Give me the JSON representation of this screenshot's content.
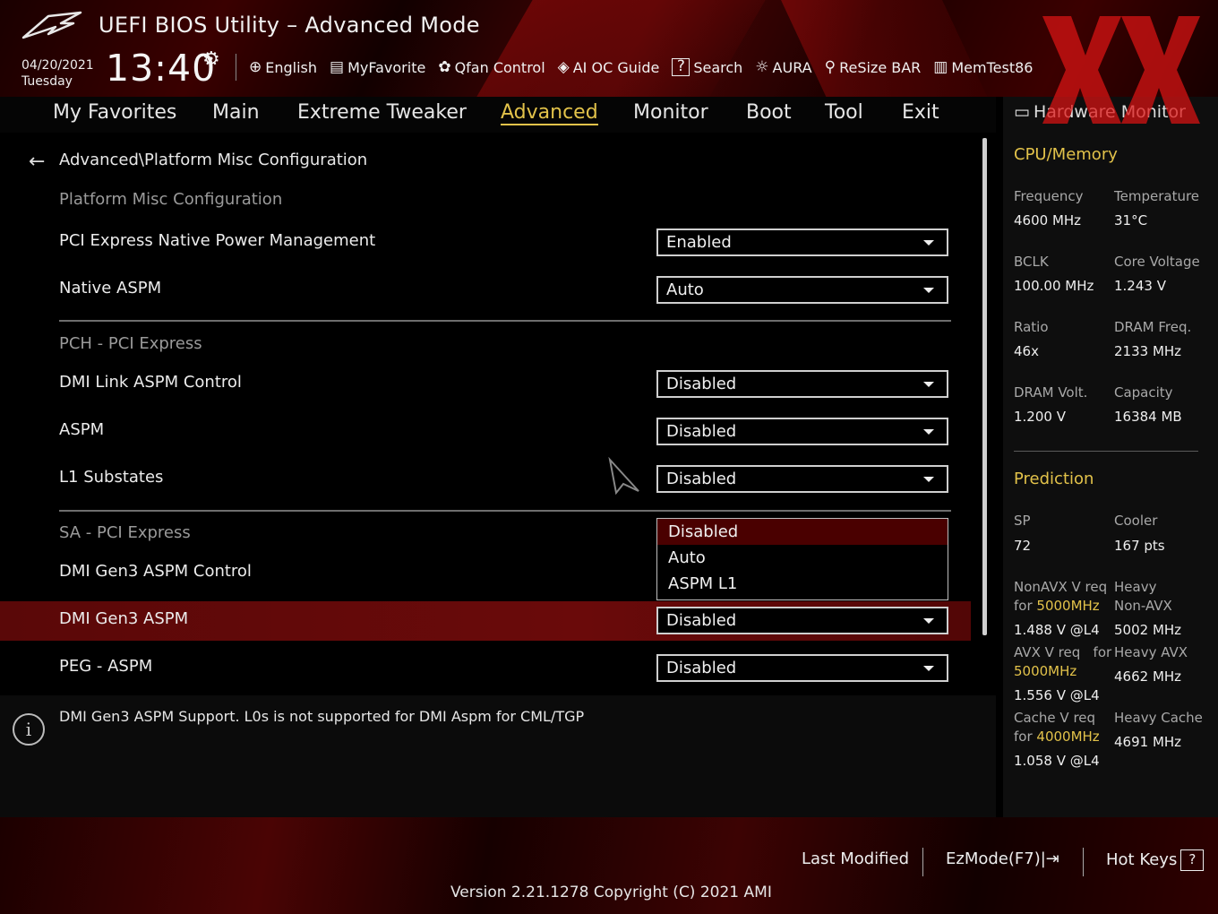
{
  "header": {
    "title": "UEFI BIOS Utility – Advanced Mode",
    "date": "04/20/2021",
    "day": "Tuesday",
    "time": "13:40",
    "toolbar": [
      {
        "label": "English",
        "icon": "globe-icon"
      },
      {
        "label": "MyFavorite",
        "icon": "favorite-icon"
      },
      {
        "label": "Qfan Control",
        "icon": "fan-icon"
      },
      {
        "label": "AI OC Guide",
        "icon": "ai-oc-icon"
      },
      {
        "label": "Search",
        "icon": "search-help-icon"
      },
      {
        "label": "AURA",
        "icon": "aura-icon"
      },
      {
        "label": "ReSize BAR",
        "icon": "resize-bar-icon"
      },
      {
        "label": "MemTest86",
        "icon": "memtest-icon"
      }
    ]
  },
  "nav": {
    "tabs": [
      "My Favorites",
      "Main",
      "Extreme Tweaker",
      "Advanced",
      "Monitor",
      "Boot",
      "Tool",
      "Exit"
    ],
    "active": "Advanced"
  },
  "main": {
    "breadcrumb": "Advanced\\Platform Misc Configuration",
    "sections": {
      "platform": "Platform Misc Configuration",
      "pch": "PCH - PCI Express",
      "sa": "SA - PCI Express"
    },
    "settings": [
      {
        "label": "PCI Express Native Power Management",
        "value": "Enabled"
      },
      {
        "label": "Native ASPM",
        "value": "Auto"
      },
      {
        "label": "DMI Link ASPM Control",
        "value": "Disabled"
      },
      {
        "label": "ASPM",
        "value": "Disabled"
      },
      {
        "label": "L1 Substates",
        "value": "Disabled"
      },
      {
        "label": "DMI Gen3 ASPM Control",
        "value": ""
      },
      {
        "label": "DMI Gen3 ASPM",
        "value": "Disabled"
      },
      {
        "label": "PEG - ASPM",
        "value": "Disabled"
      }
    ],
    "dropdown_options": [
      "Disabled",
      "Auto",
      "ASPM L1"
    ]
  },
  "help": {
    "text": "DMI Gen3 ASPM Support.  L0s is not supported for DMI Aspm for CML/TGP"
  },
  "hw": {
    "title": "Hardware Monitor",
    "cpu_section": "CPU/Memory",
    "cpu": [
      {
        "label": "Frequency",
        "value": "4600 MHz"
      },
      {
        "label": "Temperature",
        "value": "31°C"
      },
      {
        "label": "BCLK",
        "value": "100.00 MHz"
      },
      {
        "label": "Core Voltage",
        "value": "1.243 V"
      },
      {
        "label": "Ratio",
        "value": "46x"
      },
      {
        "label": "DRAM Freq.",
        "value": "2133 MHz"
      },
      {
        "label": "DRAM Volt.",
        "value": "1.200 V"
      },
      {
        "label": "Capacity",
        "value": "16384 MB"
      }
    ],
    "pred_section": "Prediction",
    "sp_label": "SP",
    "sp_value": "72",
    "cooler_label": "Cooler",
    "cooler_value": "167 pts",
    "nonavx_req": "NonAVX V req",
    "for": "for",
    "nonavx_freq": "5000MHz",
    "nonavx_v": "1.488 V @L4",
    "heavy": "Heavy",
    "non_avx": "Non-AVX",
    "heavy_nonavx_v": "5002 MHz",
    "avx_req": "AVX V req",
    "avx_for": "for",
    "avx_freq": "5000MHz",
    "avx_v": "1.556 V @L4",
    "heavy_avx": "Heavy AVX",
    "heavy_avx_v": "4662 MHz",
    "cache_req": "Cache V req",
    "cache_freq": "4000MHz",
    "cache_v": "1.058 V @L4",
    "heavy_cache": "Heavy Cache",
    "heavy_cache_v": "4691 MHz"
  },
  "footer": {
    "last_modified": "Last Modified",
    "ezmode": "EzMode(F7)|",
    "hotkeys": "Hot Keys",
    "hotkeys_key": "?",
    "version": "Version 2.21.1278 Copyright (C) 2021 AMI"
  },
  "colors": {
    "accent": "#e2c24a",
    "highlight": "#6a0a0a",
    "selected_option": "#4a0000"
  }
}
